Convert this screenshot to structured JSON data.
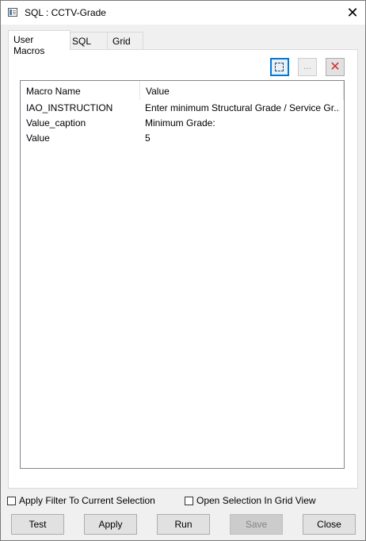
{
  "window": {
    "title": "SQL : CCTV-Grade",
    "icon": "sql-window-icon",
    "close_glyph": "✕"
  },
  "tabs": [
    {
      "label": "User Macros",
      "active": true
    },
    {
      "label": "SQL",
      "active": false
    },
    {
      "label": "Grid",
      "active": false
    }
  ],
  "toolbar": {
    "new_icon": "new-macro-icon",
    "edit_glyph": "...",
    "delete_glyph": "✕"
  },
  "macros": {
    "columns": [
      "Macro Name",
      "Value"
    ],
    "rows": [
      {
        "name": "IAO_INSTRUCTION",
        "value": "Enter minimum Structural Grade / Service Gr..."
      },
      {
        "name": "Value_caption",
        "value": "Minimum Grade:"
      },
      {
        "name": "Value",
        "value": "5"
      }
    ]
  },
  "options": {
    "apply_filter": {
      "label": "Apply Filter To Current Selection",
      "checked": false
    },
    "open_grid": {
      "label": "Open Selection In Grid View",
      "checked": false
    }
  },
  "buttons": {
    "test": "Test",
    "apply": "Apply",
    "run": "Run",
    "save": "Save",
    "close": "Close"
  },
  "colors": {
    "focus": "#0078d7",
    "delete": "#d32f2f"
  }
}
